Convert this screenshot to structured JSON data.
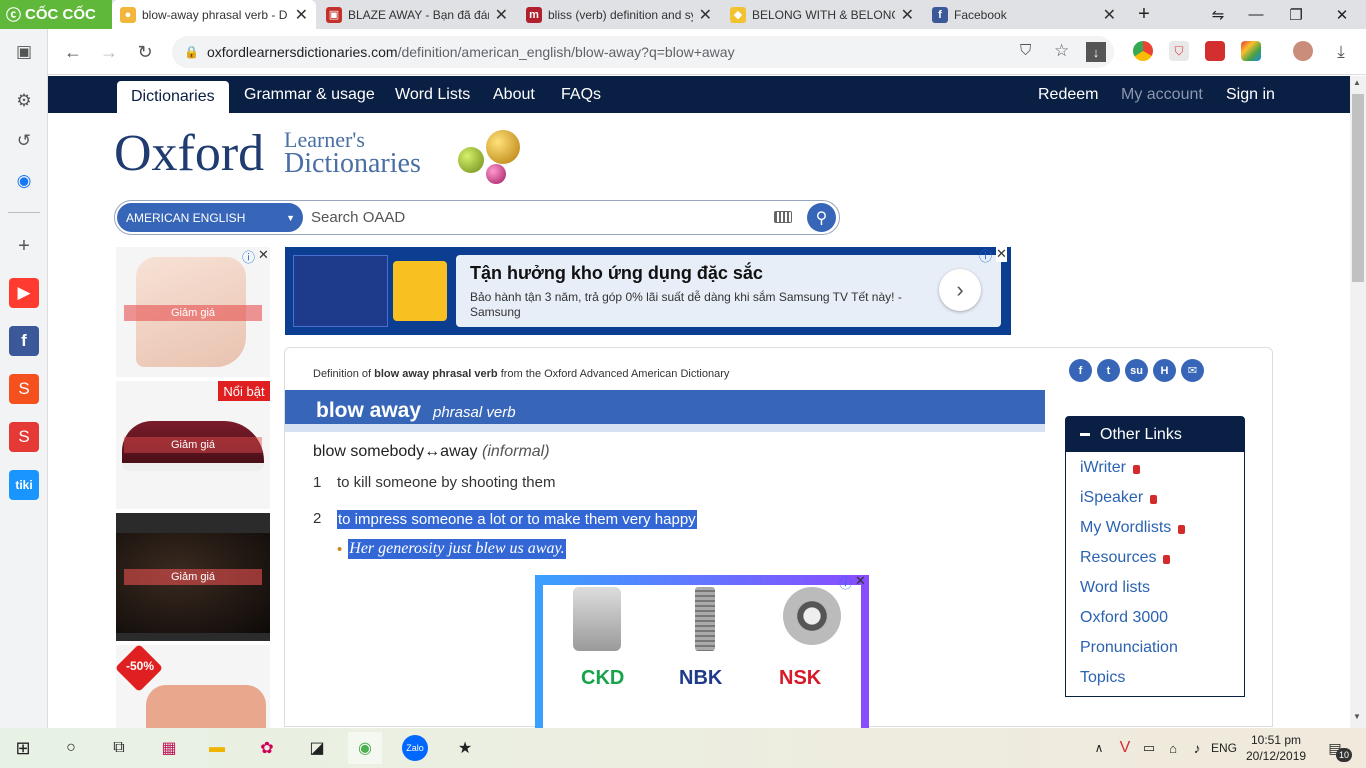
{
  "browser": {
    "brand": "CỐC CỐC",
    "tabs": [
      {
        "title": "blow-away phrasal verb - D",
        "active": true,
        "icon": "oxford-favicon"
      },
      {
        "title": "BLAZE AWAY - Bạn đã đánh",
        "active": false,
        "icon": "cambridge-favicon"
      },
      {
        "title": "bliss (verb) definition and sy",
        "active": false,
        "icon": "macmillan-favicon"
      },
      {
        "title": "BELONG WITH & BELONG T",
        "active": false,
        "icon": "shield-favicon"
      },
      {
        "title": "Facebook",
        "active": false,
        "icon": "facebook-favicon"
      }
    ],
    "url_domain": "oxfordlearnersdictionaries.com",
    "url_path": "/definition/american_english/blow-away?q=blow+away"
  },
  "site": {
    "nav_left": [
      "Dictionaries",
      "Grammar & usage",
      "Word Lists",
      "About",
      "FAQs"
    ],
    "nav_right": [
      "Redeem",
      "My account",
      "Sign in"
    ],
    "logo_main": "Oxford",
    "logo_sub1": "Learner's",
    "logo_sub2": "Dictionaries",
    "dict_select": "AMERICAN ENGLISH",
    "search_placeholder": "Search OAAD"
  },
  "ads": {
    "shoe_price_label": "Giảm giá",
    "featured_badge": "Nổi bật",
    "discount_badge": "-50%",
    "banner_title": "Tận hưởng kho ứng dụng đặc sắc",
    "banner_desc": "Bảo hành tận 3 năm, trả góp 0% lãi suất dễ dàng khi sắm Samsung TV Tết này! - Samsung",
    "brands": [
      "CKD",
      "NBK",
      "NSK"
    ]
  },
  "entry": {
    "breadcrumb_prefix": "Definition of ",
    "breadcrumb_term": "blow away phrasal verb",
    "breadcrumb_suffix": " from the Oxford Advanced American Dictionary",
    "headword": "blow away",
    "pos": "phrasal verb",
    "idiom": "blow somebody↔away",
    "register": "(informal)",
    "senses": [
      {
        "num": "1",
        "def": "to kill someone by shooting them"
      },
      {
        "num": "2",
        "def": "to impress someone a lot or to make them very happy"
      }
    ],
    "example": "Her generosity just blew us away."
  },
  "other_links": {
    "title": "Other Links",
    "items": [
      {
        "label": "iWriter",
        "locked": true
      },
      {
        "label": "iSpeaker",
        "locked": true
      },
      {
        "label": "My Wordlists",
        "locked": true
      },
      {
        "label": "Resources",
        "locked": true
      },
      {
        "label": "Word lists",
        "locked": false
      },
      {
        "label": "Oxford 3000",
        "locked": false
      },
      {
        "label": "Pronunciation",
        "locked": false
      },
      {
        "label": "Topics",
        "locked": false
      }
    ]
  },
  "taskbar": {
    "lang": "ENG",
    "time": "10:51 pm",
    "date": "20/12/2019",
    "notifications": "10"
  }
}
